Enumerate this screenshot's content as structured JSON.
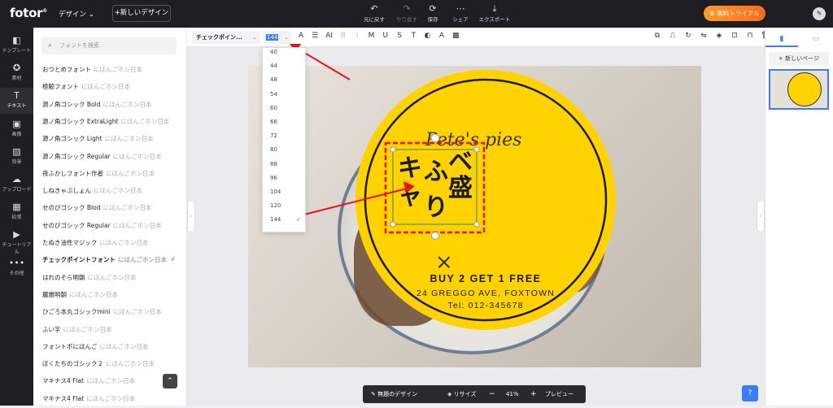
{
  "topbar": {
    "logo": "fotor",
    "design_menu": "デザイン ⌄",
    "new_design": "+新しいデザイン",
    "tools": [
      {
        "icon": "undo-icon",
        "glyph": "↶",
        "label": "元に戻す"
      },
      {
        "icon": "redo-icon",
        "glyph": "↷",
        "label": "やり直す"
      },
      {
        "icon": "save-icon",
        "glyph": "⟳",
        "label": "保存"
      },
      {
        "icon": "share-icon",
        "glyph": "⋯",
        "label": "シェア"
      },
      {
        "icon": "export-icon",
        "glyph": "⤓",
        "label": "エクスポート"
      }
    ],
    "trial_button": "♛ 無料トライアル"
  },
  "rail": {
    "items": [
      {
        "icon": "template-icon",
        "glyph": "◧",
        "label": "テンプレート"
      },
      {
        "icon": "elements-icon",
        "glyph": "✪",
        "label": "素材"
      },
      {
        "icon": "text-icon",
        "glyph": "T",
        "label": "テキスト"
      },
      {
        "icon": "image-icon",
        "glyph": "▣",
        "label": "画像"
      },
      {
        "icon": "background-icon",
        "glyph": "▨",
        "label": "背景"
      },
      {
        "icon": "upload-icon",
        "glyph": "☁",
        "label": "アップロード"
      },
      {
        "icon": "collage-icon",
        "glyph": "▦",
        "label": "拡張"
      },
      {
        "icon": "tutorial-icon",
        "glyph": "▶",
        "label": "チュートリアル"
      },
      {
        "icon": "more-icon",
        "glyph": "•••",
        "label": "その他"
      }
    ]
  },
  "fontpanel": {
    "search_placeholder": "フォントを検索",
    "fonts": [
      {
        "name": "おつとめフォント",
        "sample": "にほんごホン日本"
      },
      {
        "name": "極鯨フォント",
        "sample": "にほんごホン日本"
      },
      {
        "name": "源ノ角ゴシック Bold",
        "sample": "にほんごホン日本"
      },
      {
        "name": "源ノ角ゴシック ExtraLight",
        "sample": "にほんごホン日本"
      },
      {
        "name": "源ノ角ゴシック Light",
        "sample": "にほんごホン日本"
      },
      {
        "name": "源ノ角ゴシック Regular",
        "sample": "にほんごホン日本"
      },
      {
        "name": "夜ふかしフォント作者",
        "sample": "にほんごホン日本"
      },
      {
        "name": "しねきゃぷしょん",
        "sample": "にほんごホン日本"
      },
      {
        "name": "せのびゴシック Blod",
        "sample": "にほんごホン日本"
      },
      {
        "name": "せのびゴシック Regular",
        "sample": "にほんごホン日本"
      },
      {
        "name": "たぬき油性マジック",
        "sample": "にほんごホン日本"
      },
      {
        "name": "チェックポイントフォント",
        "sample": "にほんごホン日本"
      },
      {
        "name": "はれのそら明朝",
        "sample": "にほんごホン日本"
      },
      {
        "name": "麗雅明朝",
        "sample": "にほんごホン日本"
      },
      {
        "name": "ひごろ本丸ゴシックmini",
        "sample": "にほんごホン日本"
      },
      {
        "name": "ふい字",
        "sample": "にほんごホン日本"
      },
      {
        "name": "フォントポにほんご",
        "sample": "にほんごホン日本"
      },
      {
        "name": "ぼくたちのゴシック２",
        "sample": "にほんごホン日本"
      },
      {
        "name": "マキナス4 Flat",
        "sample": "にほんごホン日本"
      },
      {
        "name": "マキナス4 Flat",
        "sample": "にほんごホン日本"
      }
    ],
    "selected_index": 11,
    "check": "✓",
    "up_arrow": "⌃"
  },
  "format": {
    "font_name": "チェックポイン...",
    "font_size": "144",
    "chevron": "⌄",
    "buttons": [
      {
        "name": "text-color-icon",
        "glyph": "A"
      },
      {
        "name": "align-icon",
        "glyph": "☰"
      },
      {
        "name": "ai-icon",
        "glyph": "AI"
      },
      {
        "name": "bold-icon",
        "glyph": "B"
      },
      {
        "name": "italic-icon",
        "glyph": "I"
      },
      {
        "name": "letter-spacing-icon",
        "glyph": "M"
      },
      {
        "name": "underline-icon",
        "glyph": "U"
      },
      {
        "name": "strikethrough-icon",
        "glyph": "S"
      },
      {
        "name": "case-icon",
        "glyph": "T"
      },
      {
        "name": "color-picker-icon",
        "glyph": "◐"
      },
      {
        "name": "effect-icon",
        "glyph": "A"
      },
      {
        "name": "transparency-icon",
        "glyph": "▩"
      }
    ],
    "right_buttons": [
      {
        "name": "copy-icon",
        "glyph": "⧉"
      },
      {
        "name": "stamp-icon",
        "glyph": "⎍"
      },
      {
        "name": "rotate-icon",
        "glyph": "↻"
      },
      {
        "name": "flip-icon",
        "glyph": "⇋"
      },
      {
        "name": "layers-icon",
        "glyph": "◈"
      },
      {
        "name": "group-icon",
        "glyph": "⊡"
      },
      {
        "name": "lock-icon",
        "glyph": "⊓"
      },
      {
        "name": "delete-icon",
        "glyph": "🗑"
      }
    ]
  },
  "size_dropdown": {
    "options": [
      "40",
      "44",
      "48",
      "54",
      "60",
      "66",
      "72",
      "80",
      "88",
      "96",
      "104",
      "120",
      "144"
    ],
    "selected": "144",
    "check": "✓"
  },
  "artwork": {
    "brand": "Pete's pies",
    "vertical_text": "キャベ盛ふり",
    "offer": "BUY 2 GET 1 FREE",
    "address": "24 GREGGO AVE, FOXTOWN",
    "tel": "Tel: 012-345678",
    "utensils": "⨯",
    "plus": "+",
    "rotate": "⟲"
  },
  "rightpanel": {
    "tab_pages_icon": "▮",
    "tab_image_icon": "▭",
    "add_page": "+ 新しいページ"
  },
  "bottombar": {
    "design_name": "✎ 無題のデザイン",
    "resize": "◈ リサイズ",
    "minus": "−",
    "zoom": "41%",
    "plus": "+",
    "preview": "プレビュー"
  },
  "help": "?",
  "collapse_left": "‹",
  "collapse_right": "›",
  "colors": {
    "accent": "#3b7cff",
    "yellow": "#ffd200",
    "dark": "#1f1f23",
    "arrow_red": "#e8141c"
  }
}
